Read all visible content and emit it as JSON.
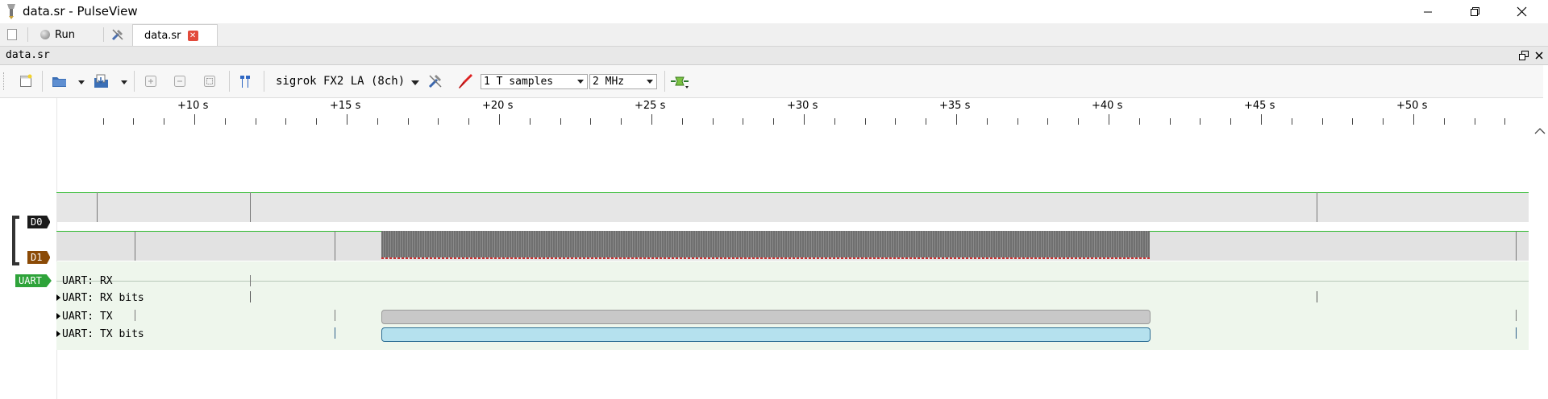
{
  "window": {
    "title": "data.sr - PulseView"
  },
  "tabs": {
    "run_label": "Run",
    "document_tab": "data.sr"
  },
  "dock": {
    "title": "data.sr"
  },
  "toolbar": {
    "device": "sigrok FX2 LA (8ch)",
    "samples": "1 T samples",
    "samplerate": "2 MHz"
  },
  "ruler": {
    "labels": [
      "+10 s",
      "+15 s",
      "+20 s",
      "+25 s",
      "+30 s",
      "+35 s",
      "+40 s",
      "+45 s",
      "+50 s"
    ]
  },
  "channels": {
    "d0": "D0",
    "d1": "D1",
    "decoder": "UART"
  },
  "decoder_rows": [
    "UART: RX",
    "UART: RX bits",
    "UART: TX",
    "UART: TX bits"
  ],
  "colors": {
    "d0_badge": "#1a1a1a",
    "d1_badge": "#8b4a06",
    "uart_badge": "#2ea33a",
    "high_line": "#2db82d",
    "tx_annotation": "#c8c8c8",
    "tx_bits_annotation": "#b5e1ee"
  },
  "icons": {
    "app": "pulseview-probe-icon",
    "new": "new-session-icon",
    "open": "open-file-icon",
    "save": "save-file-icon",
    "zoom_in": "zoom-in-icon",
    "zoom_out": "zoom-out-icon",
    "zoom_fit": "zoom-fit-icon",
    "cursors": "cursor-pair-icon",
    "configure": "configure-device-icon",
    "probe": "probe-icon",
    "decoder": "add-decoder-icon"
  }
}
